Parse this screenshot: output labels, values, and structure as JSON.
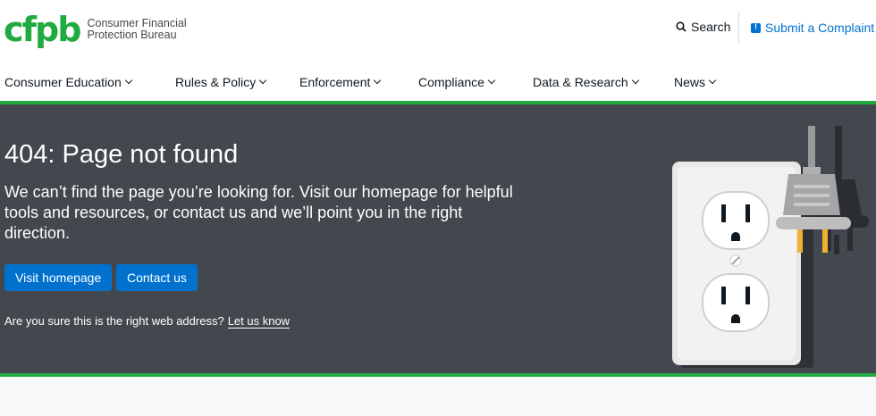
{
  "header": {
    "logo_mark": "cfpb",
    "logo_line1": "Consumer Financial",
    "logo_line2": "Protection Bureau",
    "search_label": "Search",
    "complaint_label": "Submit a Complaint"
  },
  "nav": {
    "items": [
      {
        "label": "Consumer Education"
      },
      {
        "label": "Rules & Policy"
      },
      {
        "label": "Enforcement"
      },
      {
        "label": "Compliance"
      },
      {
        "label": "Data & Research"
      },
      {
        "label": "News"
      }
    ]
  },
  "hero": {
    "title": "404: Page not found",
    "description": "We can’t find the page you’re looking for. Visit our homepage for helpful tools and resources, or contact us and we’ll point you in the right direction.",
    "primary_button": "Visit homepage",
    "secondary_button": "Contact us",
    "note_text": "Are you sure this is the right web address?",
    "note_link": "Let us know"
  },
  "colors": {
    "brand_green": "#20aa3f",
    "primary_blue": "#0072ce",
    "hero_bg": "#43484e"
  }
}
